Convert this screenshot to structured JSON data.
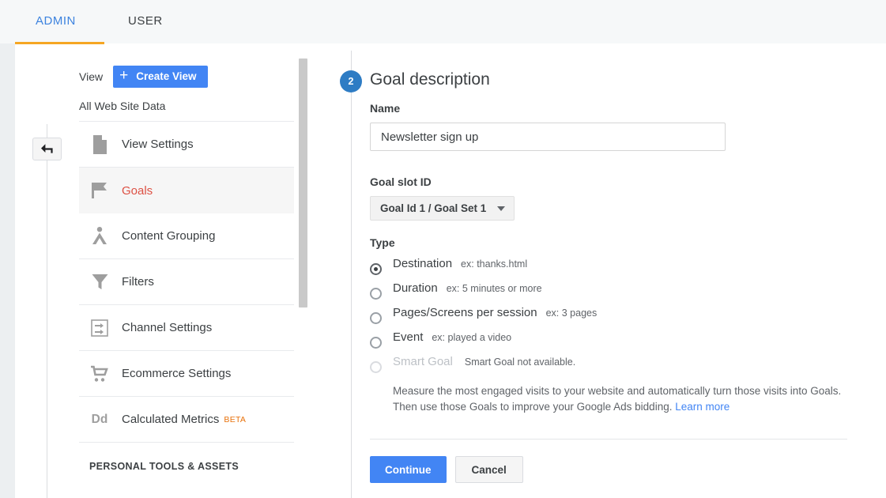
{
  "header": {
    "tabs": [
      {
        "label": "ADMIN",
        "active": true
      },
      {
        "label": "USER",
        "active": false
      }
    ]
  },
  "back_button": {
    "icon": "back-arrow-icon"
  },
  "sidebar": {
    "view_label": "View",
    "create_view_button": "Create View",
    "create_view_icon": "plus-icon",
    "view_name": "All Web Site Data",
    "items": [
      {
        "label": "View Settings",
        "icon": "document-icon",
        "active": false
      },
      {
        "label": "Goals",
        "icon": "flag-icon",
        "active": true
      },
      {
        "label": "Content Grouping",
        "icon": "content-grouping-icon",
        "active": false
      },
      {
        "label": "Filters",
        "icon": "funnel-icon",
        "active": false
      },
      {
        "label": "Channel Settings",
        "icon": "channel-settings-icon",
        "active": false
      },
      {
        "label": "Ecommerce Settings",
        "icon": "shopping-cart-icon",
        "active": false
      },
      {
        "label": "Calculated Metrics",
        "icon": "dd-icon",
        "badge": "BETA",
        "active": false
      }
    ],
    "section_heading": "PERSONAL TOOLS & ASSETS"
  },
  "main": {
    "step_number": "2",
    "title": "Goal description",
    "name_label": "Name",
    "name_value": "Newsletter sign up",
    "goal_slot_label": "Goal slot ID",
    "goal_slot_value": "Goal Id 1 / Goal Set 1",
    "type_label": "Type",
    "types": [
      {
        "label": "Destination",
        "example": "ex: thanks.html",
        "checked": true,
        "disabled": false
      },
      {
        "label": "Duration",
        "example": "ex: 5 minutes or more",
        "checked": false,
        "disabled": false
      },
      {
        "label": "Pages/Screens per session",
        "example": "ex: 3 pages",
        "checked": false,
        "disabled": false
      },
      {
        "label": "Event",
        "example": "ex: played a video",
        "checked": false,
        "disabled": false
      },
      {
        "label": "Smart Goal",
        "example": "Smart Goal not available.",
        "checked": false,
        "disabled": true
      }
    ],
    "smart_goal_description": "Measure the most engaged visits to your website and automatically turn those visits into Goals. Then use those Goals to improve your Google Ads bidding.",
    "learn_more": "Learn more",
    "continue_button": "Continue",
    "cancel_button": "Cancel"
  },
  "colors": {
    "accent_blue": "#4285f4",
    "tab_active": "#3d83df",
    "tab_underline": "#f5a623",
    "active_item": "#dd5144",
    "beta": "#e8710a",
    "step_badge": "#2e7cc4"
  }
}
